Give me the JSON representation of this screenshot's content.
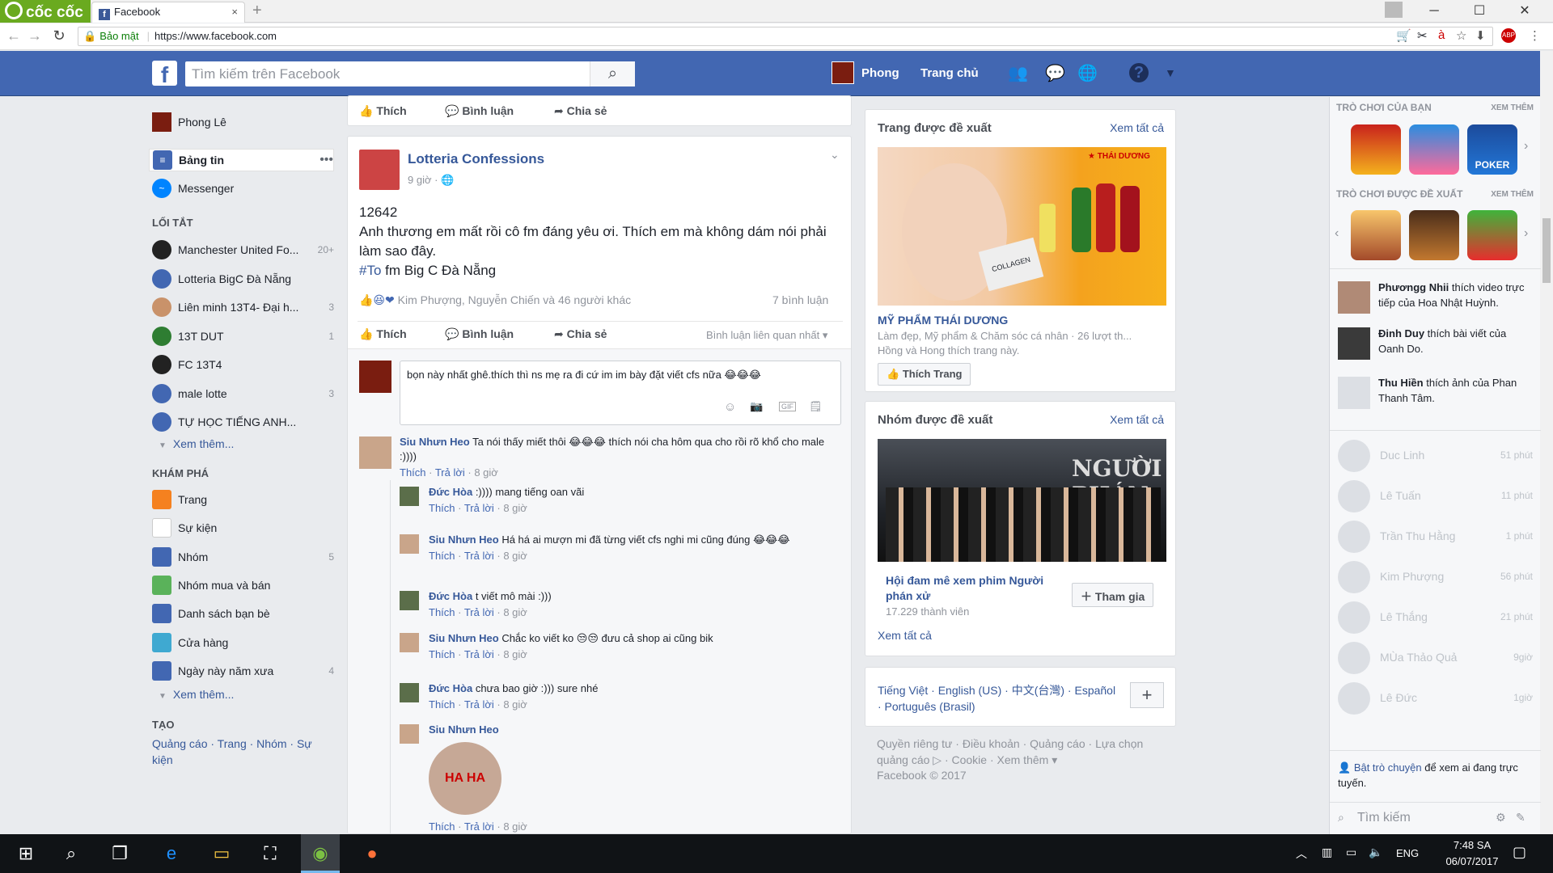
{
  "browser": {
    "brand": "cốc cốc",
    "tab_title": "Facebook",
    "tab_close": "×",
    "new_tab": "+",
    "secure_label": "Bảo mật",
    "url": "https://www.facebook.com",
    "window": {
      "minimize": "─",
      "maximize": "☐",
      "close": "✕"
    }
  },
  "header": {
    "search_placeholder": "Tìm kiếm trên Facebook",
    "user": "Phong",
    "home": "Trang chủ"
  },
  "left": {
    "profile": "Phong Lê",
    "news_feed": "Bảng tin",
    "news_more": "•••",
    "messenger": "Messenger",
    "shortcuts_title": "LỐI TẮT",
    "shortcuts": [
      {
        "label": "Manchester United Fo...",
        "count": "20+"
      },
      {
        "label": "Lotteria BigC Đà Nẵng",
        "count": ""
      },
      {
        "label": "Liên minh 13T4- Đại h...",
        "count": "3"
      },
      {
        "label": "13T DUT",
        "count": "1"
      },
      {
        "label": "FC 13T4",
        "count": ""
      },
      {
        "label": "male lotte",
        "count": "3"
      },
      {
        "label": "TỰ HỌC TIẾNG ANH...",
        "count": ""
      }
    ],
    "see_more": "Xem thêm...",
    "explore_title": "KHÁM PHÁ",
    "explore": [
      {
        "label": "Trang",
        "count": ""
      },
      {
        "label": "Sự kiện",
        "count": ""
      },
      {
        "label": "Nhóm",
        "count": "5"
      },
      {
        "label": "Nhóm mua và bán",
        "count": ""
      },
      {
        "label": "Danh sách bạn bè",
        "count": ""
      },
      {
        "label": "Cửa hàng",
        "count": ""
      },
      {
        "label": "Ngày này năm xưa",
        "count": "4"
      }
    ],
    "see_more2": "Xem thêm...",
    "create_title": "TẠO",
    "create_links": "Quảng cáo · Trang · Nhóm · Sự kiện"
  },
  "feed": {
    "top_actions": {
      "like": "Thích",
      "comment": "Bình luận",
      "share": "Chia sẻ"
    },
    "post": {
      "page": "Lotteria Confessions",
      "time": "9 giờ",
      "number": "12642",
      "text": "Anh thương em mất rồi cô fm đáng yêu ơi. Thích em mà không dám nói phải làm sao đây.",
      "hashtag": "#To",
      "text2": " fm Big C Đà Nẵng",
      "reactions": "Kim Phượng, Nguyễn Chiến và 46 người khác",
      "comments_count": "7 bình luận",
      "like": "Thích",
      "comment": "Bình luận",
      "share": "Chia sẻ",
      "sort": "Bình luận liên quan nhất ▾",
      "composer": "bọn này nhất ghê.thích thì ns mẹ ra đi cứ im im bày đặt viết cfs nữa 😂😂😂",
      "composer_icons": {
        "emoji": "☺",
        "camera": "📷",
        "gif": "GIF",
        "sticker": "🗒"
      }
    },
    "comments": [
      {
        "name": "Siu Nhưn Heo",
        "text": " Ta nói thấy miết thôi 😂😂😂 thích nói cha hôm qua cho rồi rõ khổ cho male :))))",
        "like": "Thích",
        "reply": "Trả lời",
        "time": "8 giờ"
      },
      {
        "name": "Đức Hòa",
        "text": " :)))) mang tiếng oan vãi",
        "like": "Thích",
        "reply": "Trả lời",
        "time": "8 giờ"
      },
      {
        "name": "Siu Nhưn Heo",
        "text": " Há há ai mượn mi đã từng viết cfs nghi mi cũng đúng 😂😂😂",
        "like": "Thích",
        "reply": "Trả lời",
        "time": "8 giờ"
      },
      {
        "name": "Đức Hòa",
        "text": " t viết mô mài :)))",
        "like": "Thích",
        "reply": "Trả lời",
        "time": "8 giờ"
      },
      {
        "name": "Siu Nhưn Heo",
        "text": " Chắc ko viết ko 😒😒 đưu cả shop ai cũng bik",
        "like": "Thích",
        "reply": "Trả lời",
        "time": "8 giờ"
      },
      {
        "name": "Đức Hòa",
        "text": " chưa bao giờ :))) sure nhé",
        "like": "Thích",
        "reply": "Trả lời",
        "time": "8 giờ"
      },
      {
        "name": "Siu Nhưn Heo",
        "text": "",
        "sticker": "HA HA",
        "like": "Thích",
        "reply": "Trả lời",
        "time": "8 giờ"
      }
    ]
  },
  "suggested_page": {
    "title": "Trang được đề xuất",
    "see_all": "Xem tất cả",
    "ad_brand": "★ THÁI DƯƠNG",
    "product_label": "COLLAGEN",
    "name": "MỸ PHẨM THÁI DƯƠNG",
    "desc": "Làm đẹp, Mỹ phẩm & Chăm sóc cá nhân · 26 lượt th...",
    "friends": "Hồng và Hong thích trang này.",
    "like_btn": "Thích Trang"
  },
  "suggested_group": {
    "title": "Nhóm được đề xuất",
    "see_all": "Xem tất cả",
    "banner": "NGƯỜI PHÁN XỬ",
    "name": "Hội đam mê xem phim Người phán xử",
    "members": "17.229 thành viên",
    "join": "Tham gia",
    "see_all2": "Xem tất cả"
  },
  "footer": {
    "langs": "Tiếng Việt · English (US) · 中文(台灣) · Español · Português (Brasil)",
    "add": "+",
    "links": "Quyền riêng tư · Điều khoản · Quảng cáo · Lựa chọn quảng cáo ▷ · Cookie · Xem thêm ▾",
    "copyright": "Facebook © 2017"
  },
  "chat": {
    "your_games": "TRÒ CHƠI CỦA BẠN",
    "see_more": "XEM THÊM",
    "suggested_games": "TRÒ CHƠI ĐƯỢC ĐỀ XUẤT",
    "see_more2": "XEM THÊM",
    "poker_label": "POKER",
    "ticker": [
      {
        "name": "Phươngg Nhii",
        "text": " thích video trực tiếp của Hoa Nhật Huỳnh."
      },
      {
        "name": "Đinh Duy",
        "text": " thích bài viết của Oanh Do."
      },
      {
        "name": "Thu Hiền",
        "text": " thích ảnh của Phan Thanh Tâm."
      }
    ],
    "contacts": [
      {
        "name": "Duc Linh",
        "time": "51 phút"
      },
      {
        "name": "Lê Tuấn",
        "time": "11 phút"
      },
      {
        "name": "Trần Thu Hằng",
        "time": "1 phút"
      },
      {
        "name": "Kim Phượng",
        "time": "56 phút"
      },
      {
        "name": "Lê Thắng",
        "time": "21 phút"
      },
      {
        "name": "MÙa Thảo Quả",
        "time": "9giờ"
      },
      {
        "name": "Lê Đức",
        "time": "1giờ"
      }
    ],
    "turn_on_link": "Bật trò chuyện",
    "turn_on_text": " để xem ai đang trực tuyến.",
    "search": "Tìm kiếm"
  },
  "taskbar": {
    "lang": "ENG",
    "time": "7:48 SA",
    "date": "06/07/2017"
  }
}
